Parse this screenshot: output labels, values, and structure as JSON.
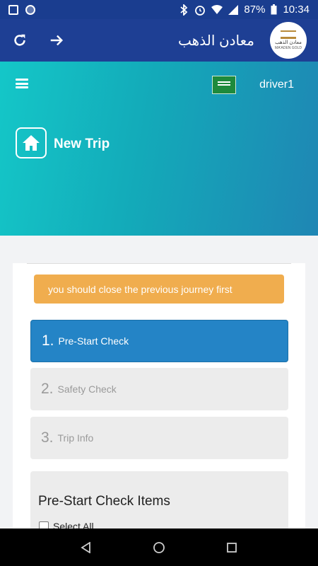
{
  "status": {
    "battery": "87%",
    "time": "10:34"
  },
  "appbar": {
    "title": "معادن الذهب",
    "logo_line1": "معادن الذهب",
    "logo_line2": "MA'ADEN GOLD"
  },
  "header": {
    "user": "driver1",
    "page_title": "New Trip"
  },
  "alert": {
    "text": "you should close the previous journey first"
  },
  "steps": [
    {
      "num": "1.",
      "label": "Pre-Start Check"
    },
    {
      "num": "2.",
      "label": "Safety Check"
    },
    {
      "num": "3.",
      "label": "Trip Info"
    }
  ],
  "panel": {
    "title": "Pre-Start Check Items",
    "select_all": "Select All"
  },
  "colors": {
    "appbar": "#1e3f94",
    "active_step": "#2484c6",
    "alert": "#f0ad4e"
  }
}
